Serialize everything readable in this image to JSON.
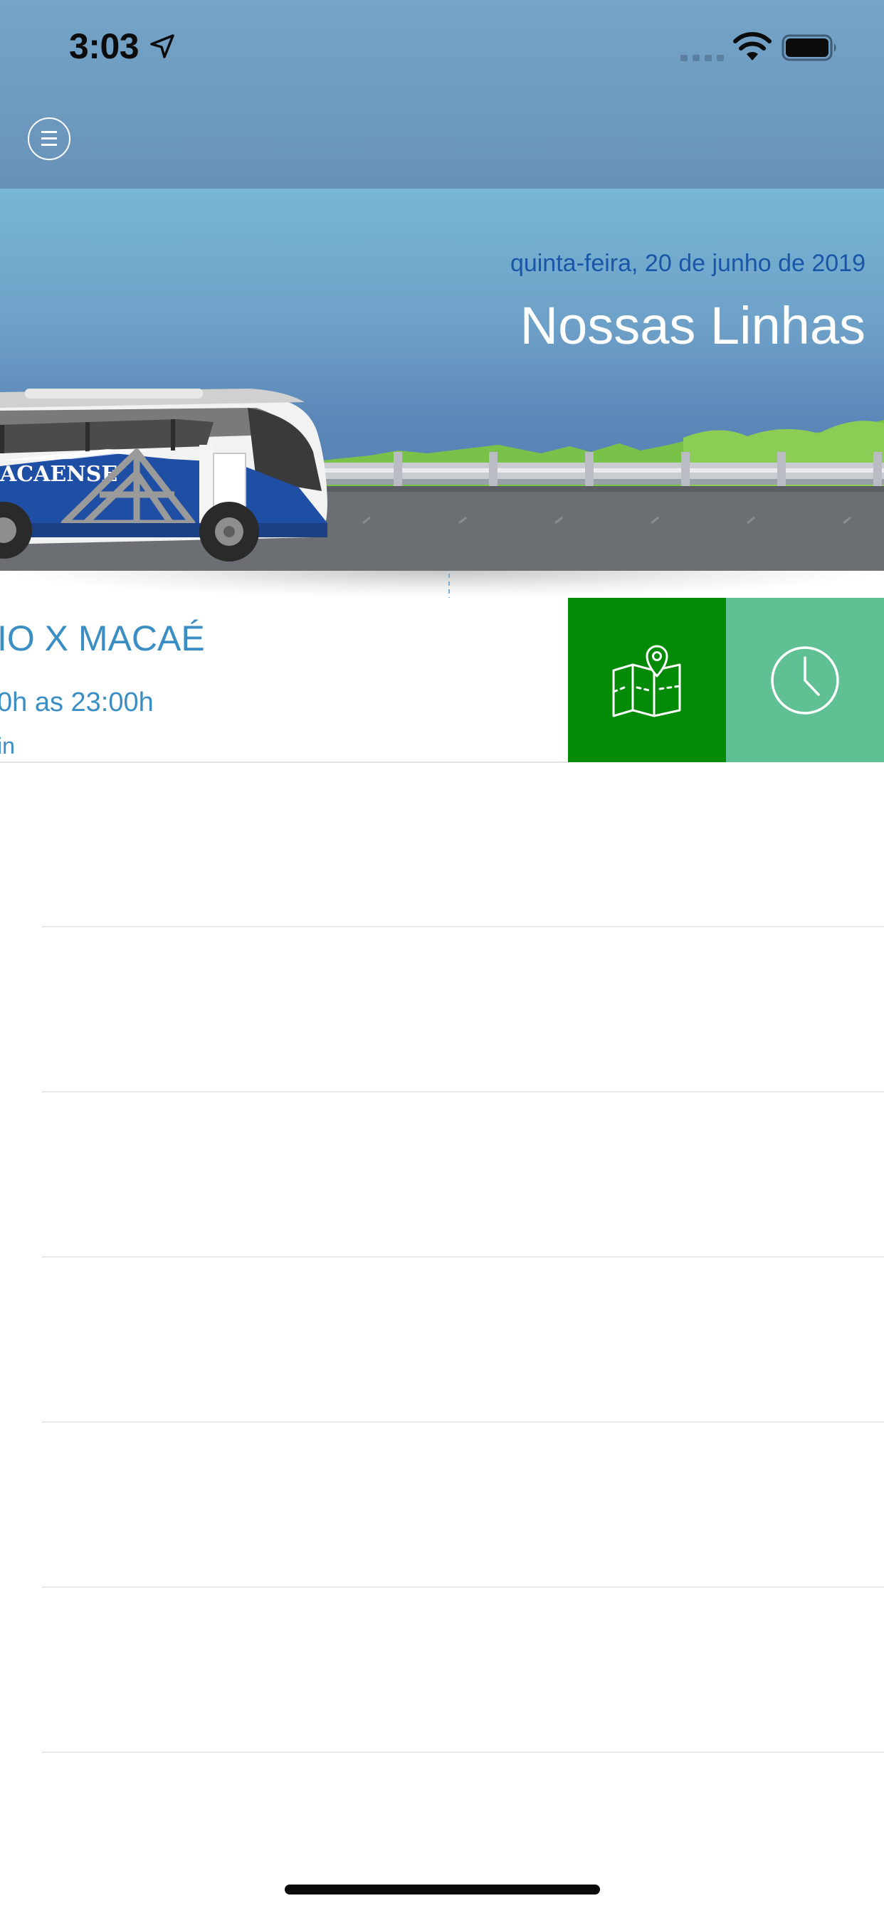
{
  "status_bar": {
    "time": "3:03",
    "icons": [
      "location-arrow-icon",
      "signal-icon",
      "wifi-icon",
      "battery-icon"
    ]
  },
  "header": {
    "menu_icon": "hamburger-circle-icon"
  },
  "hero": {
    "date": "quinta-feira, 20 de junho de 2019",
    "title": "Nossas Linhas",
    "bus_brand": "ACAENSE"
  },
  "routes": [
    {
      "name": "IO X MACAÉ",
      "hours": "0h as 23:00h",
      "duration": "in",
      "actions": [
        {
          "icon": "map-pin-icon",
          "color": "#038a06"
        },
        {
          "icon": "clock-icon",
          "color": "#5fc093"
        }
      ]
    }
  ],
  "colors": {
    "header_bg": "#6f9bc0",
    "accent_text": "#3b8ec4",
    "date_text": "#1a56a8",
    "map_action": "#038a06",
    "schedule_action": "#5fc093"
  }
}
